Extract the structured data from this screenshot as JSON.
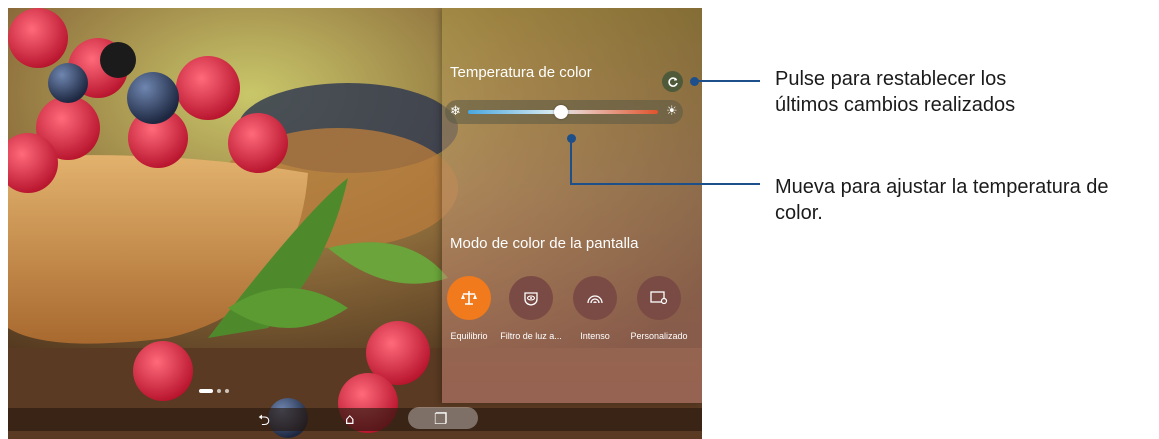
{
  "color_temperature": {
    "title": "Temperatura de color",
    "slider_level_fraction": 0.49,
    "cold_icon": "snowflake-icon",
    "warm_icon": "sun-icon",
    "reset_icon": "refresh-icon"
  },
  "color_mode": {
    "title": "Modo de color de la pantalla",
    "modes": [
      {
        "label": "Equilibrio",
        "icon": "balance-scale-icon",
        "selected": true,
        "color": "#f07a1c"
      },
      {
        "label": "Filtro de luz a...",
        "icon": "eye-filter-icon",
        "selected": false,
        "color": "#7a4a44"
      },
      {
        "label": "Intenso",
        "icon": "vivid-arc-icon",
        "selected": false,
        "color": "#7a4a44"
      },
      {
        "label": "Personalizado",
        "icon": "screen-gear-icon",
        "selected": false,
        "color": "#7a4a44"
      }
    ]
  },
  "pager": {
    "pages": 3,
    "current": 1
  },
  "navbar": {
    "back_icon": "back-icon",
    "home_icon": "home-icon",
    "recent_icon": "recent-apps-icon"
  },
  "callouts": {
    "reset_line1": "Pulse para restablecer los",
    "reset_line2": "últimos cambios realizados",
    "slider_line1": "Mueva para ajustar la temperatura de",
    "slider_line2": "color."
  },
  "colors": {
    "callout": "#1d4f8a",
    "accent": "#f07a1c"
  }
}
